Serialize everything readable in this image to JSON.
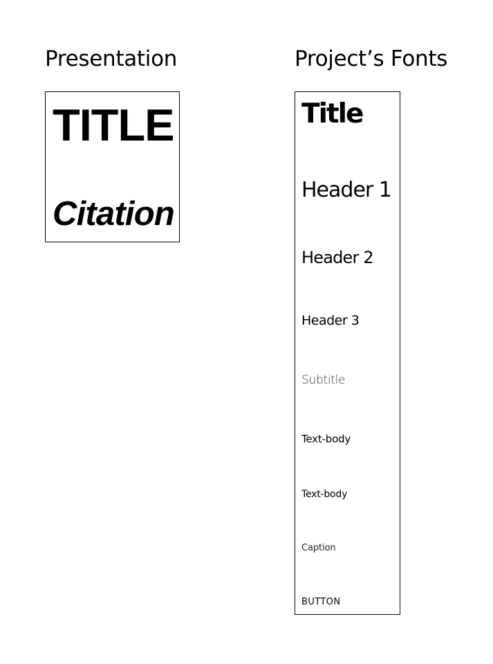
{
  "presentation": {
    "heading": "Presentation",
    "title": "TITLE",
    "citation": "Citation"
  },
  "project_fonts": {
    "heading": "Project’s Fonts",
    "samples": {
      "title": "Title",
      "header1": "Header 1",
      "header2": "Header 2",
      "header3": "Header 3",
      "subtitle": "Subtitle",
      "text_body_1": "Text-body",
      "text_body_2": "Text-body",
      "caption": "Caption",
      "button": "BUTTON"
    }
  }
}
